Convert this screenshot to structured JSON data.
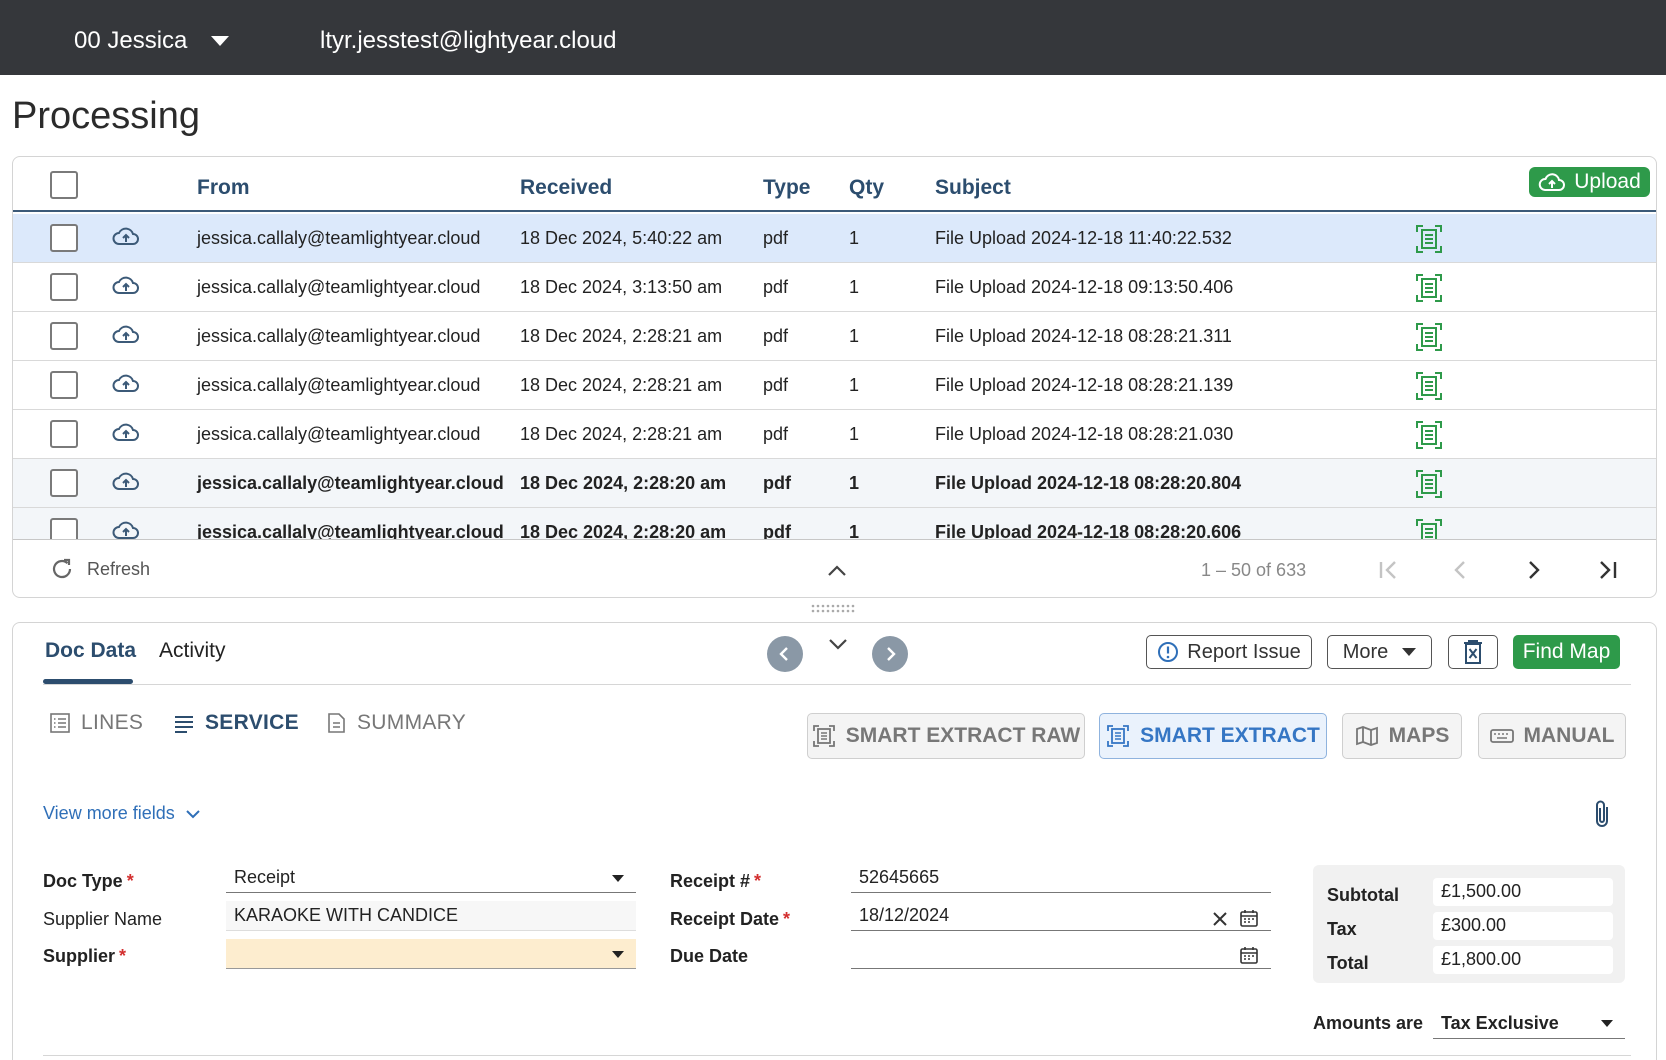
{
  "topbar": {
    "org_name": "00 Jessica",
    "user_email": "ltyr.jesstest@lightyear.cloud"
  },
  "page": {
    "title": "Processing"
  },
  "table": {
    "columns": {
      "from": "From",
      "received": "Received",
      "type": "Type",
      "qty": "Qty",
      "subject": "Subject"
    },
    "upload_label": "Upload",
    "rows": [
      {
        "from": "jessica.callaly@teamlightyear.cloud",
        "received": "18 Dec 2024, 5:40:22 am",
        "type": "pdf",
        "qty": "1",
        "subject": "File Upload 2024-12-18 11:40:22.532"
      },
      {
        "from": "jessica.callaly@teamlightyear.cloud",
        "received": "18 Dec 2024, 3:13:50 am",
        "type": "pdf",
        "qty": "1",
        "subject": "File Upload 2024-12-18 09:13:50.406"
      },
      {
        "from": "jessica.callaly@teamlightyear.cloud",
        "received": "18 Dec 2024, 2:28:21 am",
        "type": "pdf",
        "qty": "1",
        "subject": "File Upload 2024-12-18 08:28:21.311"
      },
      {
        "from": "jessica.callaly@teamlightyear.cloud",
        "received": "18 Dec 2024, 2:28:21 am",
        "type": "pdf",
        "qty": "1",
        "subject": "File Upload 2024-12-18 08:28:21.139"
      },
      {
        "from": "jessica.callaly@teamlightyear.cloud",
        "received": "18 Dec 2024, 2:28:21 am",
        "type": "pdf",
        "qty": "1",
        "subject": "File Upload 2024-12-18 08:28:21.030"
      },
      {
        "from": "jessica.callaly@teamlightyear.cloud",
        "received": "18 Dec 2024, 2:28:20 am",
        "type": "pdf",
        "qty": "1",
        "subject": "File Upload 2024-12-18 08:28:20.804"
      },
      {
        "from": "jessica.callaly@teamlightyear.cloud",
        "received": "18 Dec 2024, 2:28:20 am",
        "type": "pdf",
        "qty": "1",
        "subject": "File Upload 2024-12-18 08:28:20.606"
      }
    ],
    "footer": {
      "refresh_label": "Refresh",
      "pagination": "1 – 50 of 633"
    }
  },
  "detail": {
    "tabs": {
      "doc_data": "Doc Data",
      "activity": "Activity"
    },
    "actions": {
      "report_issue": "Report Issue",
      "more": "More",
      "find_map": "Find Map"
    },
    "subtabs": {
      "lines": "LINES",
      "service": "SERVICE",
      "summary": "SUMMARY"
    },
    "modes": {
      "smart_extract_raw": "SMART EXTRACT RAW",
      "smart_extract": "SMART EXTRACT",
      "maps": "MAPS",
      "manual": "MANUAL"
    },
    "view_more": "View more fields",
    "fields": {
      "doc_type": {
        "label": "Doc Type",
        "value": "Receipt"
      },
      "supplier_name": {
        "label": "Supplier Name",
        "value": "KARAOKE WITH CANDICE"
      },
      "supplier": {
        "label": "Supplier",
        "value": ""
      },
      "receipt_no": {
        "label": "Receipt #",
        "value": "52645665"
      },
      "receipt_date": {
        "label": "Receipt Date",
        "value": "18/12/2024"
      },
      "due_date": {
        "label": "Due Date",
        "value": ""
      }
    },
    "totals": {
      "subtotal": {
        "label": "Subtotal",
        "value": "£1,500.00"
      },
      "tax": {
        "label": "Tax",
        "value": "£300.00"
      },
      "total": {
        "label": "Total",
        "value": "£1,800.00"
      }
    },
    "amounts": {
      "label": "Amounts are",
      "value": "Tax Exclusive"
    }
  },
  "colors": {
    "topbar": "#35373b",
    "accent_green": "#2e9a4a",
    "header_blue": "#2c4d6e",
    "selected_row": "#dce9fb",
    "link_blue": "#2f6fb8",
    "warn_field": "#fdedcf"
  }
}
